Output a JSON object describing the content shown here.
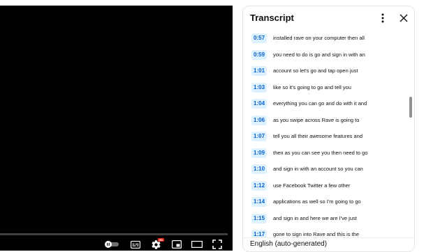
{
  "player": {
    "controls": {
      "autoplay_icon": "autoplay-toggle-icon",
      "captions_icon": "subtitles-icon",
      "settings_icon": "gear-icon",
      "settings_badge": "HD",
      "miniplayer_icon": "miniplayer-icon",
      "theater_icon": "theater-mode-icon",
      "fullscreen_icon": "fullscreen-icon"
    }
  },
  "transcript": {
    "title": "Transcript",
    "more_icon": "more-vert-icon",
    "close_icon": "close-icon",
    "accent_color": "#065fd4",
    "timestamp_bg": "#def1ff",
    "segments": [
      {
        "time": "0:57",
        "text": "installed rave on your computer then all"
      },
      {
        "time": "0:59",
        "text": "you need to do is go and sign in with an"
      },
      {
        "time": "1:01",
        "text": "account so let's go and tap open just"
      },
      {
        "time": "1:03",
        "text": "like so it's going to go and tell you"
      },
      {
        "time": "1:04",
        "text": "everything you can go and do with it and"
      },
      {
        "time": "1:06",
        "text": "as you swipe across Rave is going to"
      },
      {
        "time": "1:07",
        "text": "tell you all their awesome features and"
      },
      {
        "time": "1:09",
        "text": "then as you can see you then need to go"
      },
      {
        "time": "1:10",
        "text": "and sign in with an account so you can"
      },
      {
        "time": "1:12",
        "text": "use Facebook Twitter a few other"
      },
      {
        "time": "1:14",
        "text": "applications as well so I'm going to go"
      },
      {
        "time": "1:15",
        "text": "and sign in and here we are I've just"
      },
      {
        "time": "1:17",
        "text": "gone to sign into Rave and this is the"
      }
    ],
    "footer_language": "English (auto-generated)"
  }
}
